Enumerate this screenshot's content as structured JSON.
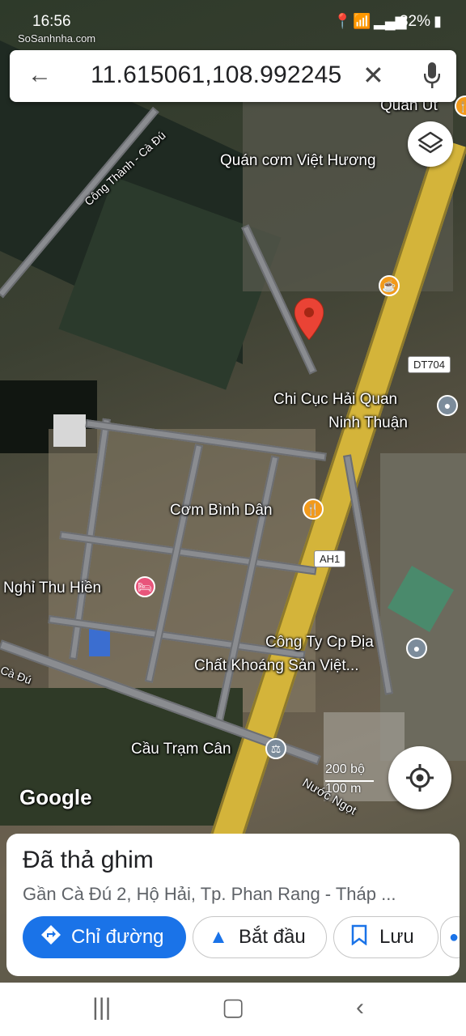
{
  "status_bar": {
    "time": "16:56",
    "watermark": "SoSanhnha.com",
    "battery": "32%"
  },
  "search": {
    "value": "11.615061,108.992245",
    "back_icon": "arrow-back-icon",
    "clear_icon": "close-icon",
    "mic_icon": "mic-icon"
  },
  "map": {
    "labels": {
      "quan_ut": "Quán Út",
      "quan_com": "Quán cơm Việt Hương",
      "cong_thanh": "Công Thành - Cà Đú",
      "dt704": "DT704",
      "chi_cuc_1": "Chi Cục Hải Quan",
      "chi_cuc_2": "Ninh Thuận",
      "com_binh_dan": "Cơm Bình Dân",
      "ah1": "AH1",
      "nghi_thu_hien": "Nghỉ Thu Hiền",
      "cong_ty_1": "Công Ty Cp Địa",
      "cong_ty_2": "Chất Khoáng Sản Việt...",
      "ca_du": "Cà Đú",
      "cau_tram_can": "Cầu Trạm Cân",
      "nuoc_ngot": "Nước Ngọt"
    },
    "scale_ft": "200 bộ",
    "scale_m": "100 m",
    "logo": "Google",
    "pin_color": "#ea4335"
  },
  "sheet": {
    "title": "Đã thả ghim",
    "address": "Gần Cà Đú 2, Hộ Hải, Tp. Phan Rang - Tháp ...",
    "buttons": {
      "directions": "Chỉ đường",
      "start": "Bắt đầu",
      "save": "Lưu"
    },
    "accent": "#1a73e8"
  },
  "nav": {
    "recent_icon": "recent-apps-icon",
    "home_icon": "home-icon",
    "back_icon": "back-icon"
  }
}
